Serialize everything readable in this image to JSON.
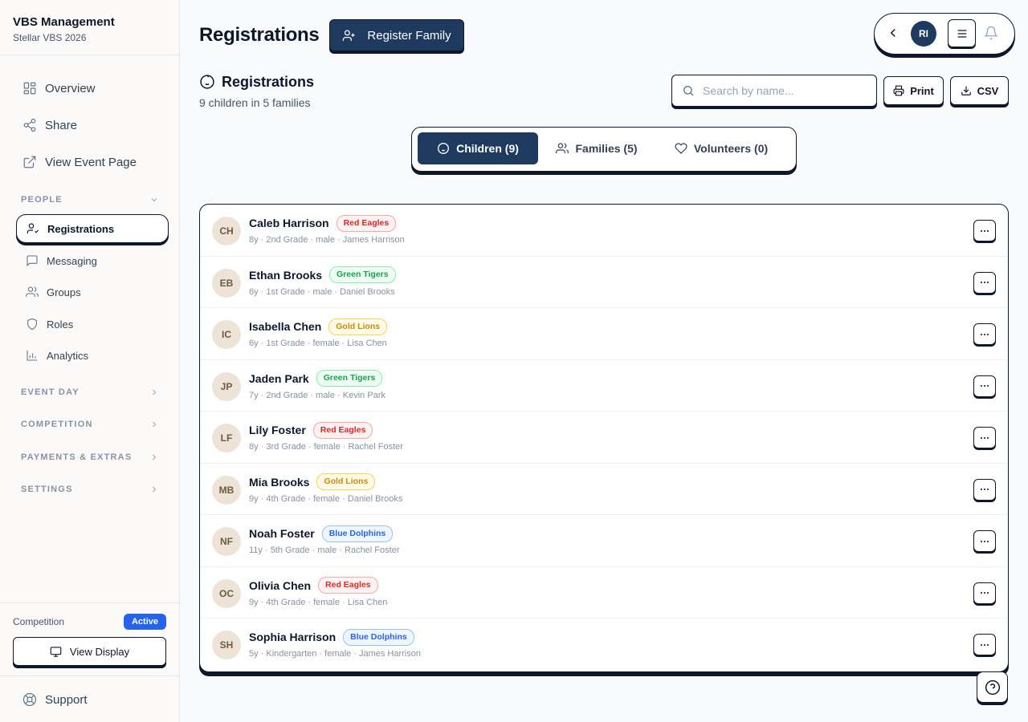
{
  "sidebar": {
    "brand_title": "VBS Management",
    "brand_sub": "Stellar VBS 2026",
    "top_items": [
      {
        "label": "Overview",
        "icon": "grid-icon"
      },
      {
        "label": "Share",
        "icon": "share-icon"
      },
      {
        "label": "View Event Page",
        "icon": "external-link-icon"
      }
    ],
    "people_label": "PEOPLE",
    "people_items": [
      {
        "label": "Registrations",
        "icon": "user-check-icon",
        "active": true
      },
      {
        "label": "Messaging",
        "icon": "message-icon"
      },
      {
        "label": "Groups",
        "icon": "users-icon"
      },
      {
        "label": "Roles",
        "icon": "shield-icon"
      },
      {
        "label": "Analytics",
        "icon": "bar-chart-icon"
      }
    ],
    "sections": [
      "EVENT DAY",
      "COMPETITION",
      "PAYMENTS & EXTRAS",
      "SETTINGS"
    ],
    "competition_label": "Competition",
    "competition_status": "Active",
    "view_display_label": "View Display",
    "support_label": "Support"
  },
  "header": {
    "title": "Registrations",
    "register_label": "Register Family",
    "avatar_initials": "RI"
  },
  "section": {
    "title": "Registrations",
    "subtitle": "9 children in 5 families",
    "search_placeholder": "Search by name...",
    "print_label": "Print",
    "csv_label": "CSV"
  },
  "tabs": [
    {
      "label": "Children (9)",
      "active": true
    },
    {
      "label": "Families (5)",
      "active": false
    },
    {
      "label": "Volunteers (0)",
      "active": false
    }
  ],
  "children": [
    {
      "initials": "CH",
      "name": "Caleb Harrison",
      "team": "Red Eagles",
      "team_color": "red",
      "meta": "8y · 2nd Grade · male · James Harrison"
    },
    {
      "initials": "EB",
      "name": "Ethan Brooks",
      "team": "Green Tigers",
      "team_color": "green",
      "meta": "6y · 1st Grade · male · Daniel Brooks"
    },
    {
      "initials": "IC",
      "name": "Isabella Chen",
      "team": "Gold Lions",
      "team_color": "gold",
      "meta": "6y · 1st Grade · female · Lisa Chen"
    },
    {
      "initials": "JP",
      "name": "Jaden Park",
      "team": "Green Tigers",
      "team_color": "green",
      "meta": "7y · 2nd Grade · male · Kevin Park"
    },
    {
      "initials": "LF",
      "name": "Lily Foster",
      "team": "Red Eagles",
      "team_color": "red",
      "meta": "8y · 3rd Grade · female · Rachel Foster"
    },
    {
      "initials": "MB",
      "name": "Mia Brooks",
      "team": "Gold Lions",
      "team_color": "gold",
      "meta": "9y · 4th Grade · female · Daniel Brooks"
    },
    {
      "initials": "NF",
      "name": "Noah Foster",
      "team": "Blue Dolphins",
      "team_color": "blue",
      "meta": "11y · 5th Grade · male · Rachel Foster"
    },
    {
      "initials": "OC",
      "name": "Olivia Chen",
      "team": "Red Eagles",
      "team_color": "red",
      "meta": "9y · 4th Grade · female · Lisa Chen"
    },
    {
      "initials": "SH",
      "name": "Sophia Harrison",
      "team": "Blue Dolphins",
      "team_color": "blue",
      "meta": "5y · Kindergarten · female · James Harrison"
    }
  ],
  "colors": {
    "primary": "#1e3a5f",
    "accent_blue": "#2563eb",
    "border": "#0f172a"
  }
}
